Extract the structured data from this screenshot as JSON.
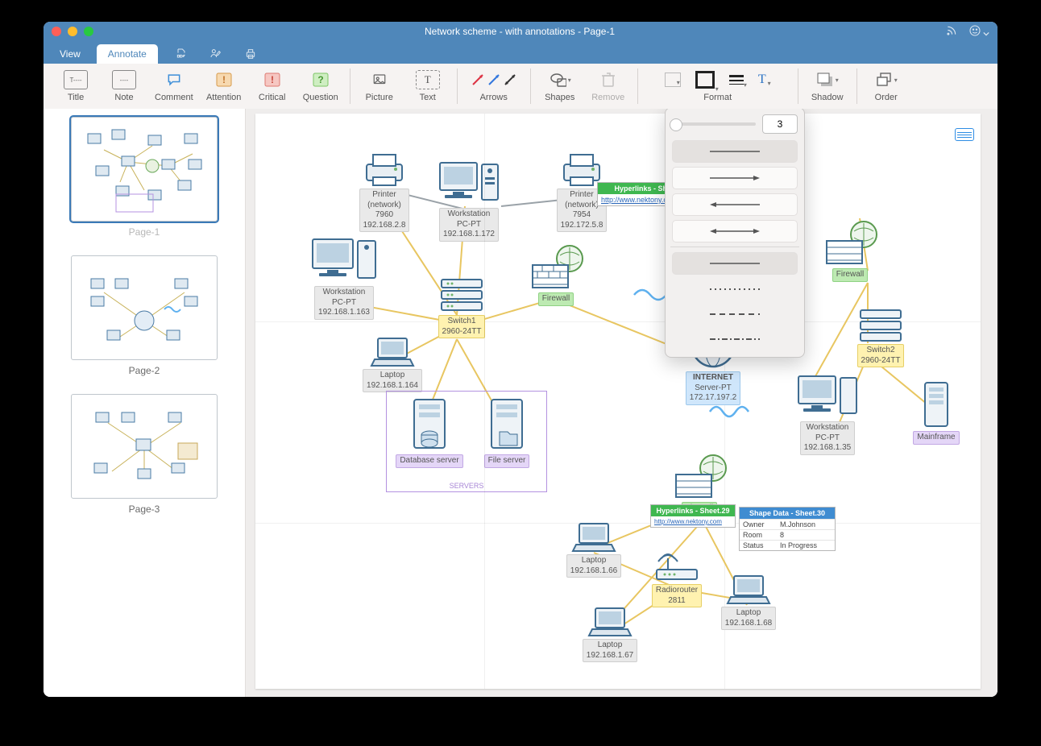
{
  "window": {
    "title": "Network scheme - with annotations - Page-1"
  },
  "tabs": {
    "view": "View",
    "annotate": "Annotate"
  },
  "toolbar": {
    "title": "Title",
    "note": "Note",
    "comment": "Comment",
    "attention": "Attention",
    "critical": "Critical",
    "question": "Question",
    "picture": "Picture",
    "text": "Text",
    "arrows": "Arrows",
    "shapes": "Shapes",
    "remove": "Remove",
    "format": "Format",
    "shadow": "Shadow",
    "order": "Order"
  },
  "format_popover": {
    "width_value": "3"
  },
  "sidebar": {
    "pages": [
      "Page-1",
      "Page-2",
      "Page-3"
    ]
  },
  "diagram": {
    "printer1": {
      "name": "Printer",
      "sub": "(network)",
      "model": "7960",
      "ip": "192.168.2.8"
    },
    "printer2": {
      "name": "Printer",
      "sub": "(network)",
      "model": "7954",
      "ip": "192.172.5.8"
    },
    "ws1": {
      "name": "Workstation",
      "sub": "PC-PT",
      "ip": "192.168.1.172"
    },
    "ws2": {
      "name": "Workstation",
      "sub": "PC-PT",
      "ip": "192.168.1.163"
    },
    "laptop1": {
      "name": "Laptop",
      "ip": "192.168.1.164"
    },
    "switch1": {
      "name": "Switch1",
      "model": "2960-24TT"
    },
    "firewall1": {
      "name": "Firewall"
    },
    "servers": {
      "db": "Database server",
      "file": "File server",
      "group": "SERVERS"
    },
    "internet": {
      "name": "INTERNET",
      "sub": "Server-PT",
      "ip": "172.17.197.2"
    },
    "firewall2": {
      "name": "Firewall"
    },
    "firewall3": {
      "name": "Firewall"
    },
    "switch2": {
      "name": "Switch2",
      "model": "2960-24TT"
    },
    "ws3": {
      "name": "Workstation",
      "sub": "PC-PT",
      "ip": "192.168.1.35"
    },
    "mainframe": {
      "name": "Mainframe"
    },
    "laptop2": {
      "name": "Laptop",
      "ip": "192.168.1.66"
    },
    "laptop3": {
      "name": "Laptop",
      "ip": "192.168.1.67"
    },
    "laptop4": {
      "name": "Laptop",
      "ip": "192.168.1.68"
    },
    "router": {
      "name": "Radiorouter",
      "model": "2811"
    },
    "hyper1": {
      "title": "Hyperlinks - Sheet.24",
      "url": "http://www.nektony.com"
    },
    "hyper2": {
      "title": "Hyperlinks - Sheet.29",
      "url": "http://www.nektony.com"
    },
    "shapedata": {
      "title": "Shape Data - Sheet.30",
      "rows": [
        [
          "Owner",
          "M.Johnson"
        ],
        [
          "Room",
          "8"
        ],
        [
          "Status",
          "In Progress"
        ]
      ]
    }
  }
}
